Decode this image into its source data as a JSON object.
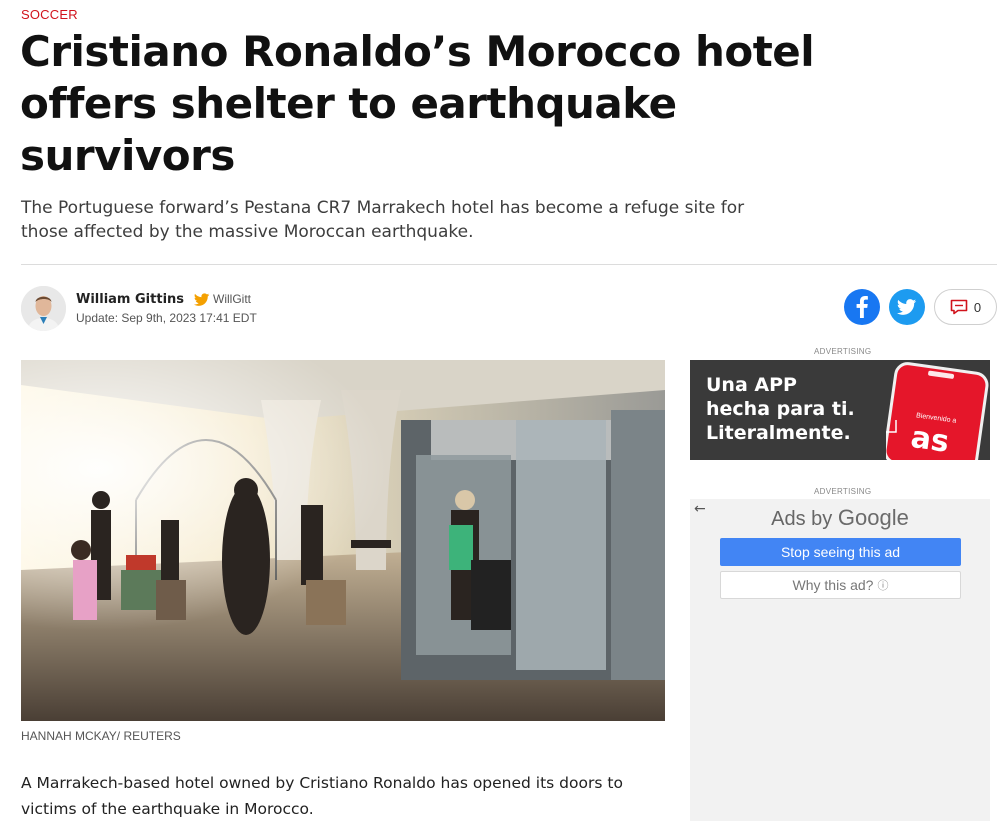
{
  "article": {
    "section": "SOCCER",
    "headline": "Cristiano Ronaldo’s Morocco hotel offers shelter to earthquake survivors",
    "subhead": "The Portuguese forward’s Pestana CR7 Marrakech hotel has become a refuge site for those affected by the massive Moroccan earthquake.",
    "author": {
      "name": "William Gittins",
      "handle": "WillGitt",
      "updated": "Update: Sep 9th, 2023 17:41 EDT"
    },
    "share": {
      "facebook_icon": "facebook-icon",
      "twitter_icon": "twitter-icon",
      "comments_count": "0"
    },
    "photo_caption": "HANNAH MCKAY/ REUTERS",
    "body": "A Marrakech-based hotel owned by Cristiano Ronaldo has opened its doors to victims of the earthquake in Morocco."
  },
  "ads": {
    "label": "ADVERTISING",
    "app_ad": {
      "lines": [
        "Una APP",
        "hecha para ti.",
        "Literalmente."
      ],
      "phone_text": "Bienvenido a",
      "brand": "as"
    },
    "google_ad": {
      "back_glyph": "←",
      "ads_by": "Ads by",
      "google": "Google",
      "stop_label": "Stop seeing this ad",
      "why_label": "Why this ad?",
      "info_glyph": "ⓘ"
    }
  },
  "colors": {
    "section_red": "#d1131c",
    "facebook_blue": "#1877f2",
    "twitter_blue": "#1d9bf0",
    "google_blue": "#4285f4",
    "verified_gold": "#f4a000"
  }
}
